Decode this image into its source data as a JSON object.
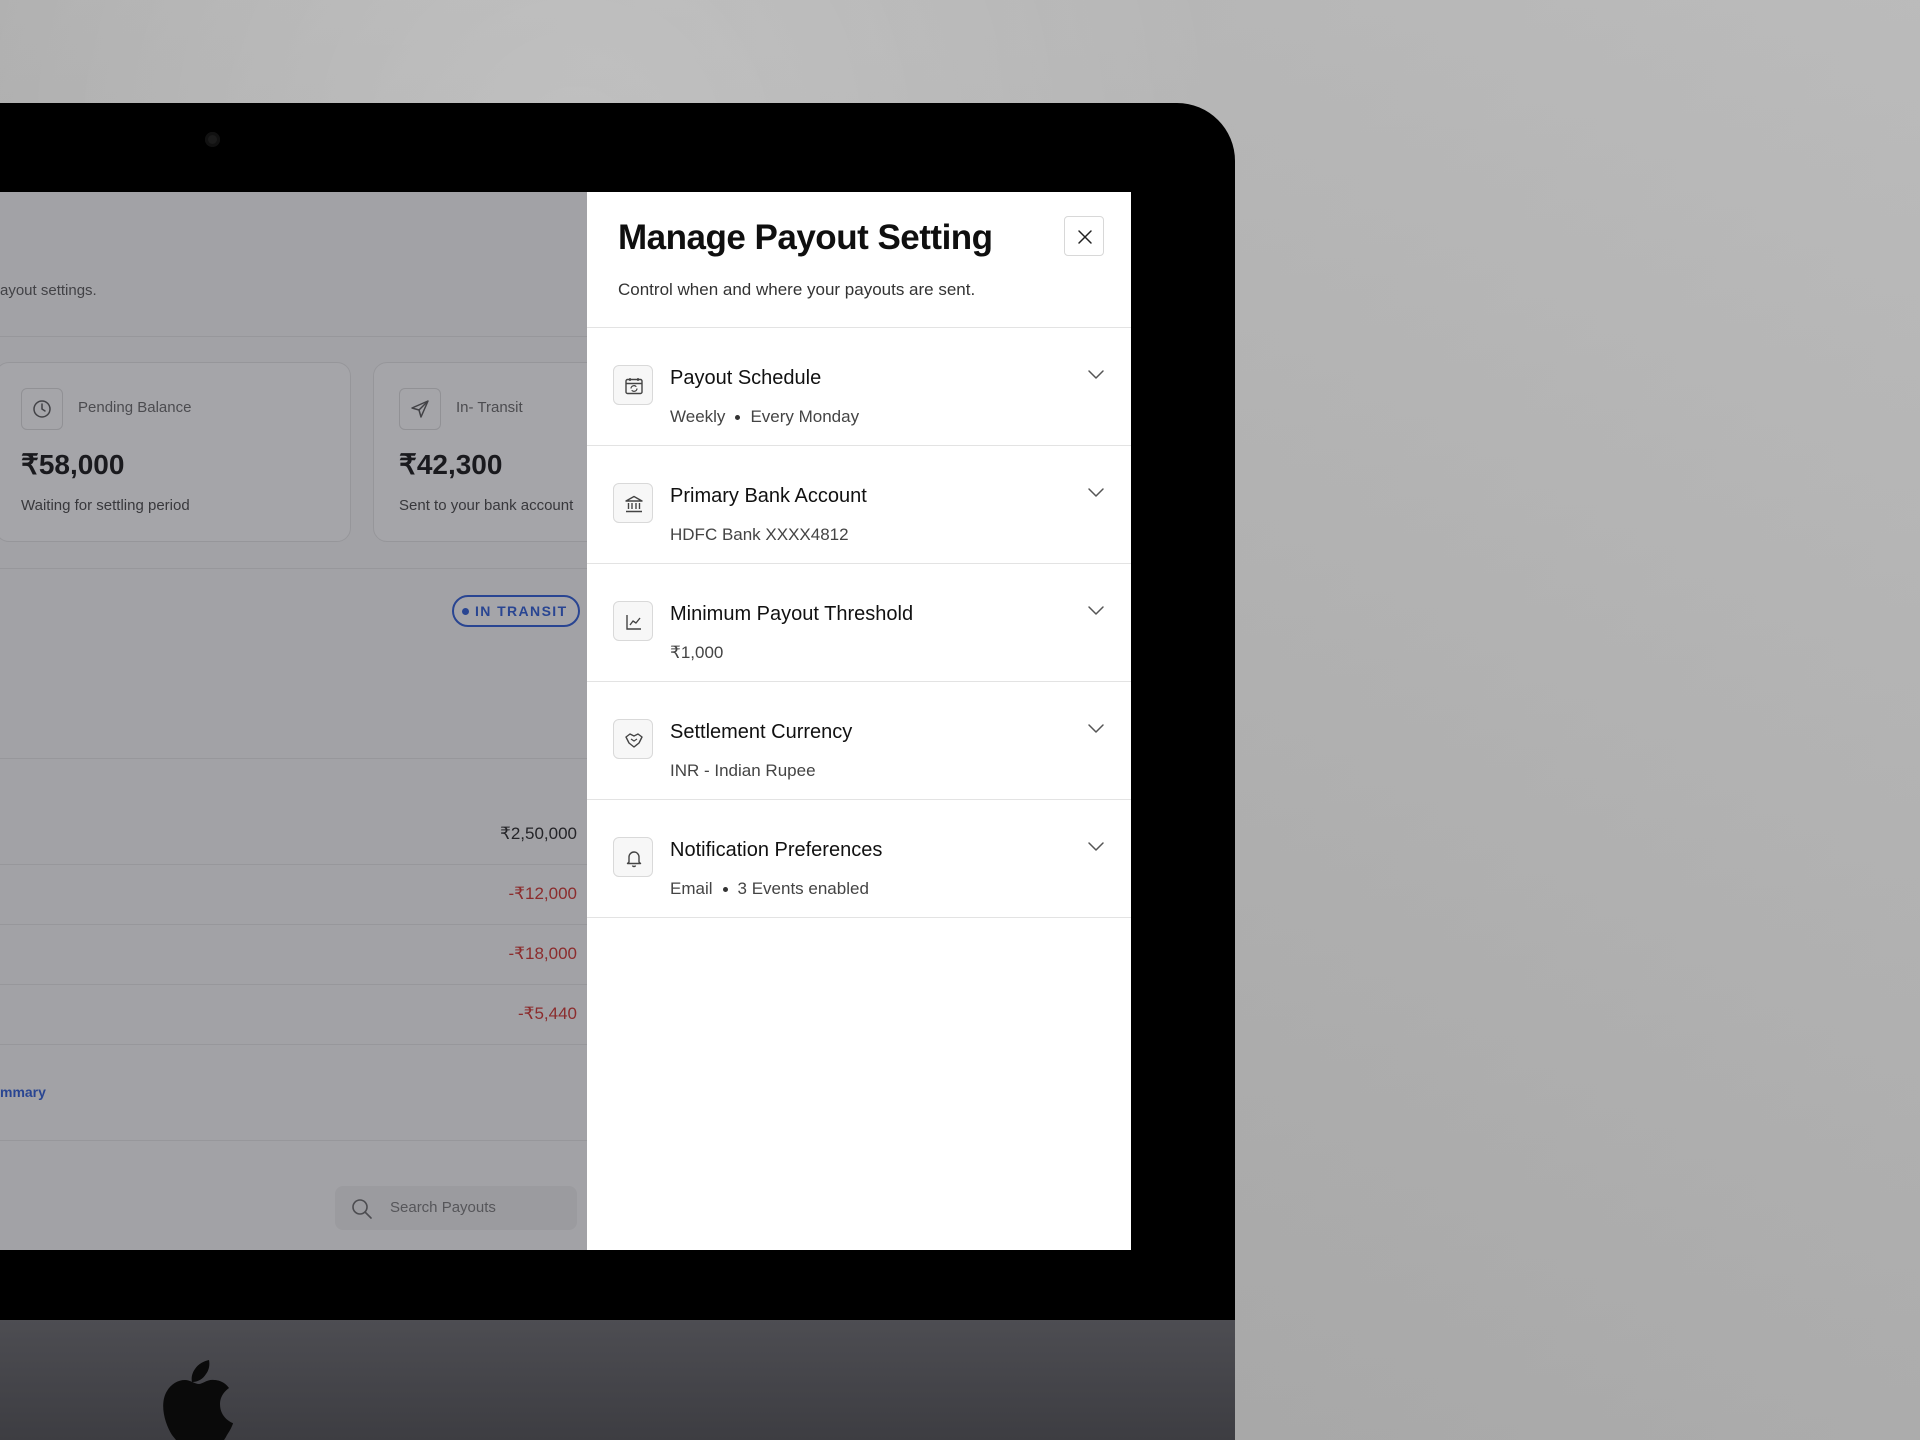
{
  "background_app": {
    "page_subtitle": "ayout settings.",
    "cards": [
      {
        "label": "Pending Balance",
        "amount": "₹58,000",
        "note": "Waiting for settling period",
        "icon": "clock-icon"
      },
      {
        "label": "In- Transit",
        "amount": "₹42,300",
        "note": "Sent to your bank account",
        "icon": "send-icon"
      }
    ],
    "status_badge": "IN TRANSIT",
    "breakdown": [
      {
        "amount": "₹2,50,000",
        "kind": "positive"
      },
      {
        "amount": "-₹12,000",
        "kind": "negative"
      },
      {
        "amount": "-₹18,000",
        "kind": "negative"
      },
      {
        "amount": "-₹5,440",
        "kind": "negative"
      }
    ],
    "summary_link": "mmary",
    "search": {
      "placeholder": "Search Payouts",
      "icon": "search-icon"
    }
  },
  "drawer": {
    "title": "Manage Payout Setting",
    "subtitle": "Control when and where your payouts are sent.",
    "close_icon": "close-icon",
    "settings": [
      {
        "title": "Payout Schedule",
        "values": [
          "Weekly",
          "Every Monday"
        ],
        "icon": "calendar-sync-icon"
      },
      {
        "title": "Primary Bank Account",
        "values": [
          "HDFC Bank XXXX4812"
        ],
        "icon": "bank-icon"
      },
      {
        "title": "Minimum Payout Threshold",
        "values": [
          "₹1,000"
        ],
        "icon": "chart-line-icon"
      },
      {
        "title": "Settlement Currency",
        "values": [
          "INR - Indian Rupee"
        ],
        "icon": "handshake-icon"
      },
      {
        "title": "Notification Preferences",
        "values": [
          "Email",
          "3 Events enabled"
        ],
        "icon": "bell-icon"
      }
    ]
  },
  "colors": {
    "accent": "#2a5bd7",
    "negative": "#d2302a",
    "overlay": "rgba(40, 40, 50, 0.42)"
  }
}
